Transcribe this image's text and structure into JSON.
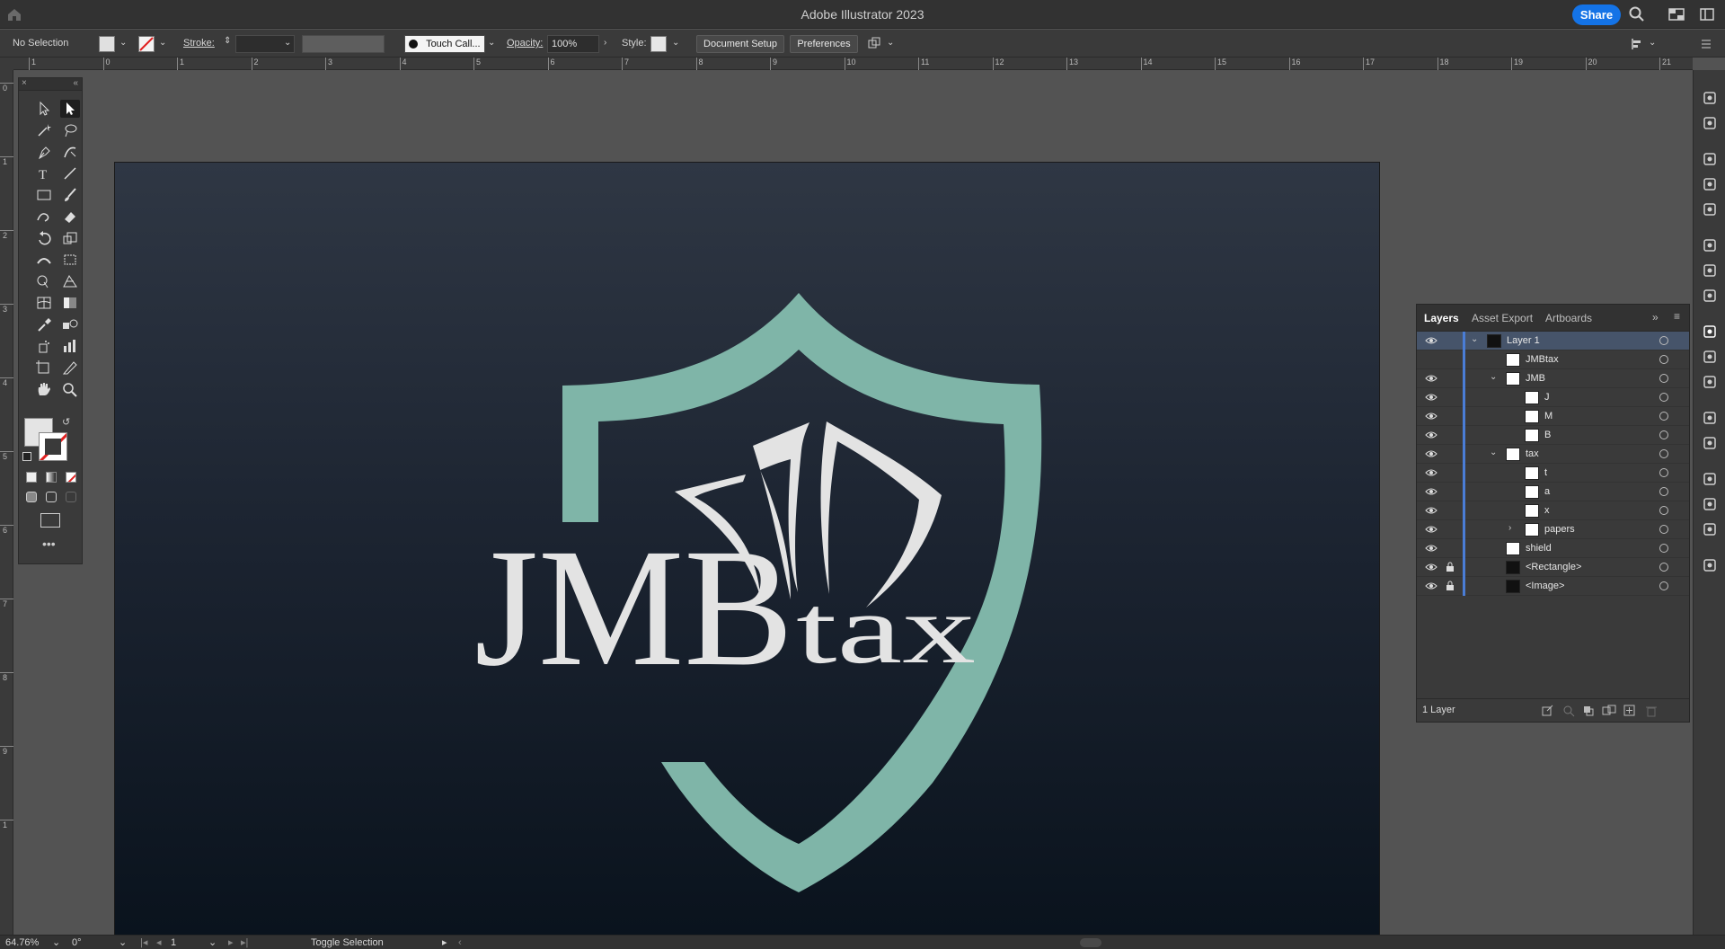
{
  "app": {
    "title": "Adobe Illustrator 2023",
    "share_label": "Share"
  },
  "control": {
    "selection": "No Selection",
    "stroke_label": "Stroke:",
    "brush": "Touch Call...",
    "opacity_label": "Opacity:",
    "opacity_value": "100%",
    "style_label": "Style:",
    "document_setup": "Document Setup",
    "preferences": "Preferences"
  },
  "ruler": {
    "h_ticks": [
      "1",
      "0",
      "1",
      "2",
      "3",
      "4",
      "5",
      "6",
      "7",
      "8",
      "9",
      "10",
      "11",
      "12",
      "13",
      "14",
      "15",
      "16",
      "17",
      "18",
      "19",
      "20",
      "21"
    ],
    "v_ticks": [
      "0",
      "1",
      "2",
      "3",
      "4",
      "5",
      "6",
      "7",
      "8",
      "9",
      "1"
    ]
  },
  "artwork": {
    "wordmark_main": "JMB",
    "wordmark_tail": "tax",
    "shield_color": "#7fb5a8",
    "text_color": "#e3e3e3"
  },
  "layers": {
    "tabs": [
      "Layers",
      "Asset Export",
      "Artboards"
    ],
    "rows": [
      {
        "name": "Layer 1",
        "eye": true,
        "lock": false,
        "indent": 0,
        "caret": "open",
        "selected": true
      },
      {
        "name": "JMBtax",
        "eye": false,
        "lock": false,
        "indent": 1,
        "caret": "",
        "selected": false
      },
      {
        "name": "JMB",
        "eye": true,
        "lock": false,
        "indent": 1,
        "caret": "open",
        "selected": false
      },
      {
        "name": "J",
        "eye": true,
        "lock": false,
        "indent": 2,
        "caret": "",
        "selected": false
      },
      {
        "name": "M",
        "eye": true,
        "lock": false,
        "indent": 2,
        "caret": "",
        "selected": false
      },
      {
        "name": "B",
        "eye": true,
        "lock": false,
        "indent": 2,
        "caret": "",
        "selected": false
      },
      {
        "name": "tax",
        "eye": true,
        "lock": false,
        "indent": 1,
        "caret": "open",
        "selected": false
      },
      {
        "name": "t",
        "eye": true,
        "lock": false,
        "indent": 2,
        "caret": "",
        "selected": false
      },
      {
        "name": "a",
        "eye": true,
        "lock": false,
        "indent": 2,
        "caret": "",
        "selected": false
      },
      {
        "name": "x",
        "eye": true,
        "lock": false,
        "indent": 2,
        "caret": "",
        "selected": false
      },
      {
        "name": "papers",
        "eye": true,
        "lock": false,
        "indent": 2,
        "caret": "closed",
        "selected": false
      },
      {
        "name": "shield",
        "eye": true,
        "lock": false,
        "indent": 1,
        "caret": "",
        "selected": false
      },
      {
        "name": "<Rectangle>",
        "eye": true,
        "lock": true,
        "indent": 1,
        "caret": "",
        "selected": false
      },
      {
        "name": "<Image>",
        "eye": true,
        "lock": true,
        "indent": 1,
        "caret": "",
        "selected": false
      }
    ],
    "footer_count": "1 Layer"
  },
  "status": {
    "zoom": "64.76%",
    "rotation": "0°",
    "artboard_num": "1",
    "toggle": "Toggle Selection"
  }
}
